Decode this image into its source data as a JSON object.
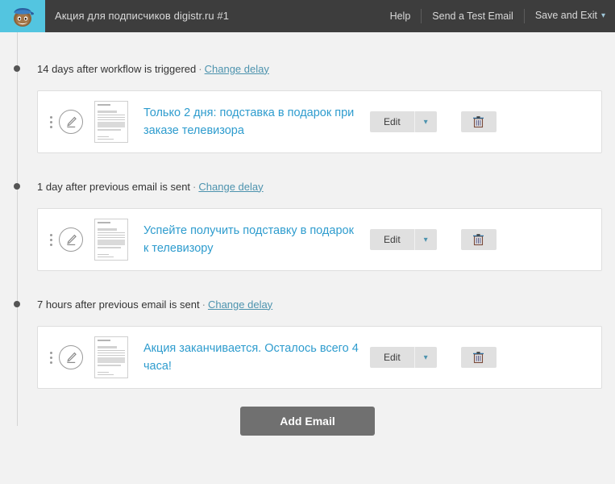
{
  "header": {
    "logo_icon": "mailchimp-freddie-icon",
    "logo_bg": "#53c5e0",
    "bar_bg": "#3d3d3d",
    "title": "Акция для подписчиков digistr.ru #1",
    "nav": {
      "help": "Help",
      "send_test": "Send a Test Email",
      "save_exit": "Save and Exit",
      "caret": "▾"
    }
  },
  "theme": {
    "page_bg": "#f2f2f2",
    "card_bg": "#ffffff",
    "link": "#2e9cce",
    "delay_link": "#4d93ae",
    "button_bg": "#e0e0e0",
    "add_button_bg": "#707070"
  },
  "separator": "·",
  "steps": [
    {
      "delay_text": "14 days after workflow is triggered",
      "change_delay_label": "Change delay",
      "email": {
        "subject": "Только 2 дня: подставка в подарок при заказе телевизора",
        "edit_label": "Edit",
        "caret": "▾",
        "trash_icon": "trash-icon",
        "drag_icon": "drag-handle-icon",
        "edit_icon": "pencil-circle-icon",
        "thumb_icon": "email-preview-thumbnail"
      }
    },
    {
      "delay_text": "1 day after previous email is sent",
      "change_delay_label": "Change delay",
      "email": {
        "subject": "Успейте получить подставку в подарок к телевизору",
        "edit_label": "Edit",
        "caret": "▾",
        "trash_icon": "trash-icon",
        "drag_icon": "drag-handle-icon",
        "edit_icon": "pencil-circle-icon",
        "thumb_icon": "email-preview-thumbnail"
      }
    },
    {
      "delay_text": "7 hours after previous email is sent",
      "change_delay_label": "Change delay",
      "email": {
        "subject": "Акция заканчивается. Осталось всего 4 часа!",
        "edit_label": "Edit",
        "caret": "▾",
        "trash_icon": "trash-icon",
        "drag_icon": "drag-handle-icon",
        "edit_icon": "pencil-circle-icon",
        "thumb_icon": "email-preview-thumbnail"
      }
    }
  ],
  "footer": {
    "add_email_label": "Add Email"
  }
}
